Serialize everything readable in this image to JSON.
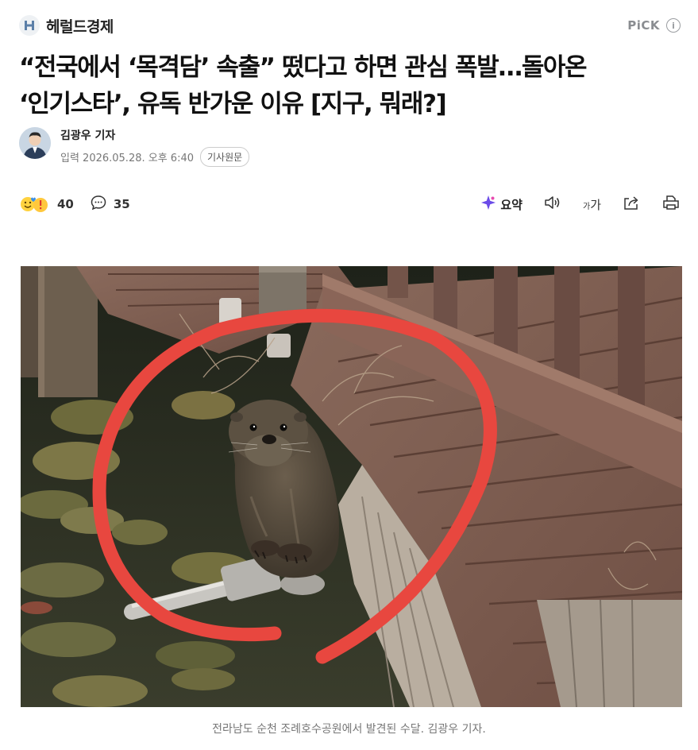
{
  "header": {
    "brand": "헤럴드경제",
    "pick": "PiCK",
    "brand_logo_icon": "herald-logo-icon",
    "info_icon": "info-icon"
  },
  "article": {
    "headline_line1": "“전국에서 ‘목격담’ 속출” 떴다고 하면 관심 폭발…돌아온",
    "headline_line2": "‘인기스타’, 유독 반가운 이유 [지구, 뭐래?]",
    "author": "김광우 기자",
    "date": "입력 2026.05.28. 오후 6:40",
    "original_button": "기사원문",
    "caption": "전라남도 순천 조례호수공원에서 발견된 수달. 김광우 기자."
  },
  "actions": {
    "reactions_count": "40",
    "comments_count": "35",
    "summary_label": "요약",
    "font_small": "가",
    "font_large": "가",
    "icons": [
      "reaction-emoji-icon",
      "comment-icon",
      "sparkle-icon",
      "speaker-icon",
      "share-icon",
      "print-icon"
    ]
  },
  "colors": {
    "highlight_circle": "#e8473f",
    "text_primary": "#111111",
    "text_secondary": "#777777"
  }
}
